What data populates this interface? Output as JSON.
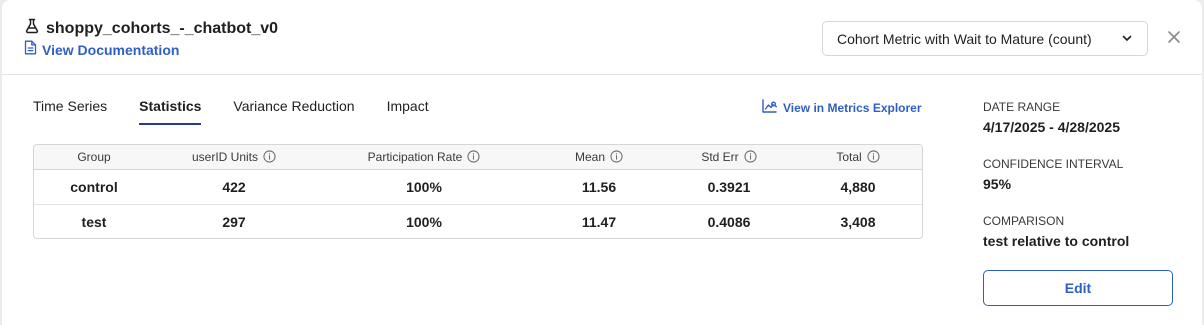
{
  "header": {
    "title": "shoppy_cohorts_-_chatbot_v0",
    "doc_link": "View Documentation",
    "metric_select": "Cohort Metric with Wait to Mature (count)"
  },
  "tabs": [
    {
      "label": "Time Series"
    },
    {
      "label": "Statistics",
      "active": true
    },
    {
      "label": "Variance Reduction"
    },
    {
      "label": "Impact"
    }
  ],
  "explorer_link": "View in Metrics Explorer",
  "table": {
    "columns": [
      "Group",
      "userID Units",
      "Participation Rate",
      "Mean",
      "Std Err",
      "Total"
    ],
    "rows": [
      [
        "control",
        "422",
        "100%",
        "11.56",
        "0.3921",
        "4,880"
      ],
      [
        "test",
        "297",
        "100%",
        "11.47",
        "0.4086",
        "3,408"
      ]
    ]
  },
  "side": {
    "date_range_label": "DATE RANGE",
    "date_range_value": "4/17/2025 - 4/28/2025",
    "ci_label": "CONFIDENCE INTERVAL",
    "ci_value": "95%",
    "comparison_label": "COMPARISON",
    "comparison_value": "test relative to control",
    "edit_label": "Edit"
  },
  "colors": {
    "accent": "#2f5fc4",
    "tab_underline": "#2b3a8f"
  }
}
